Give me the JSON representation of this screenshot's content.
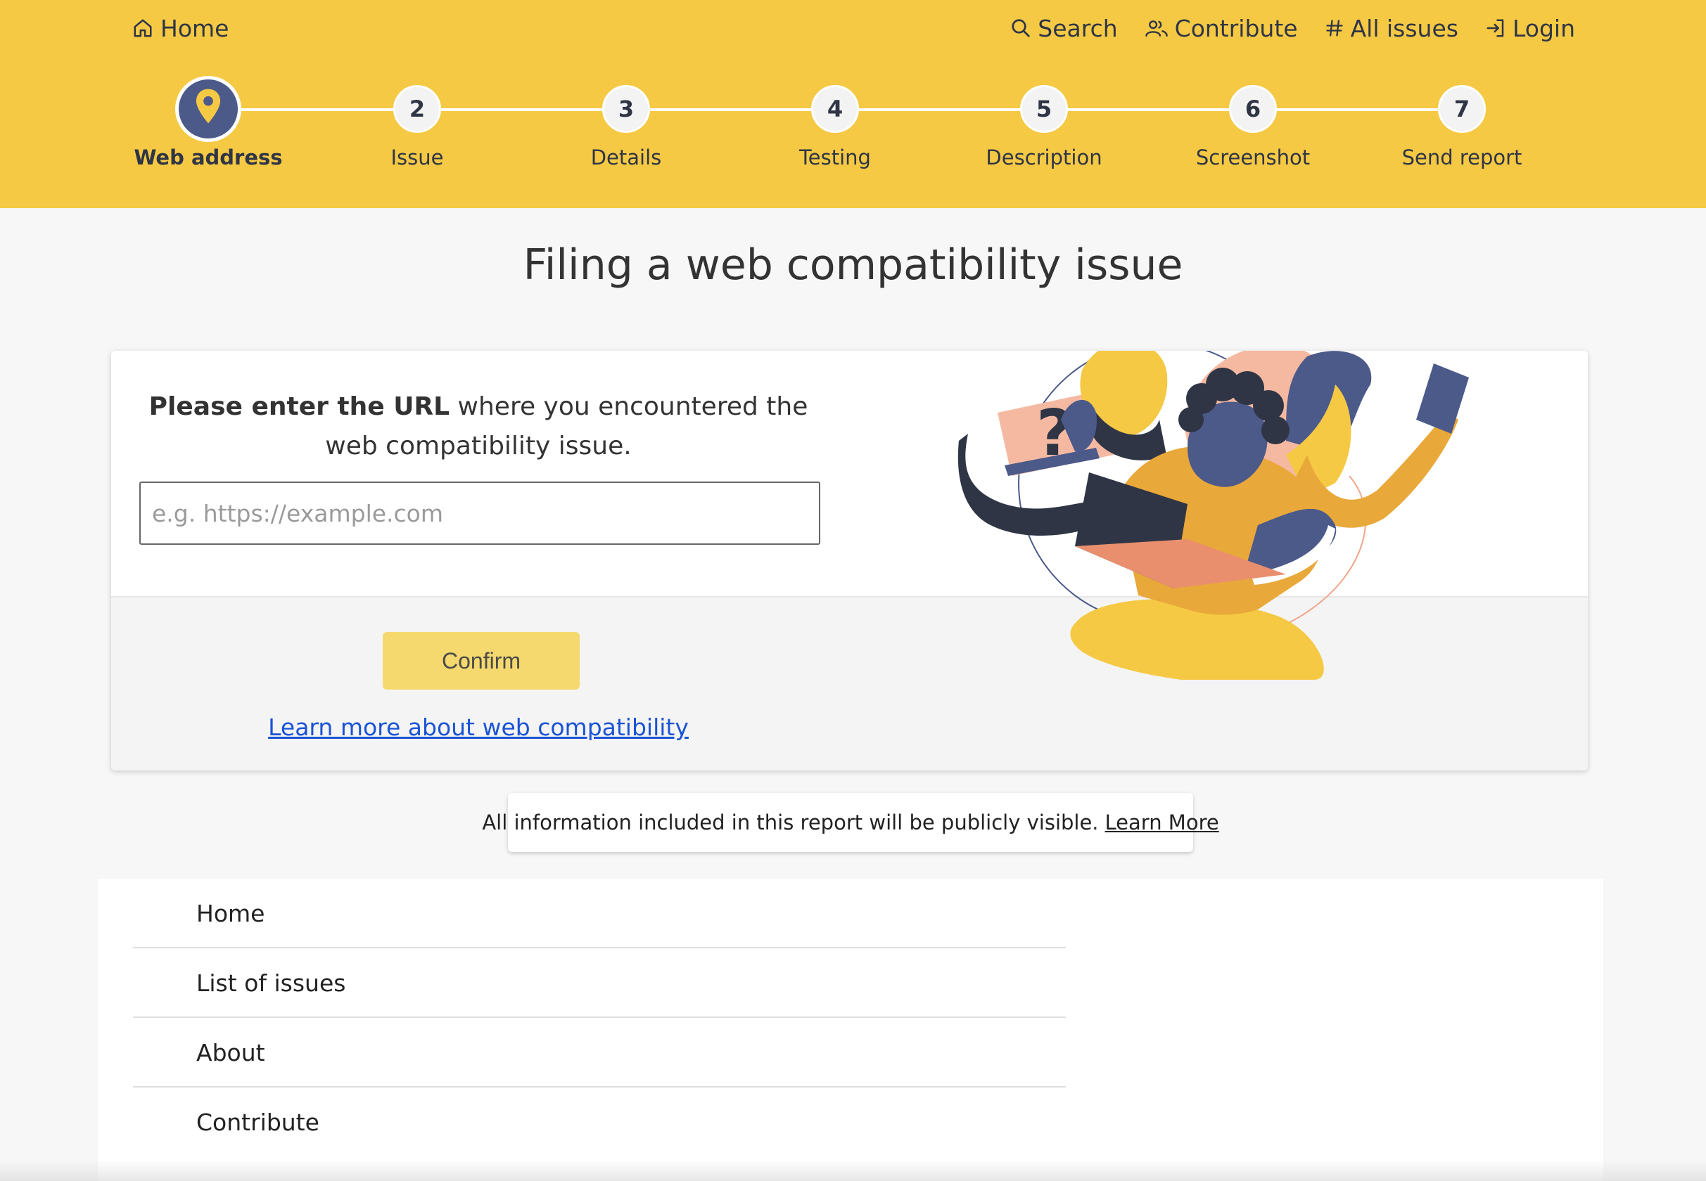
{
  "topnav": {
    "home_label": "Home",
    "links": [
      {
        "label": "Search",
        "icon": "search-icon"
      },
      {
        "label": "Contribute",
        "icon": "people-icon"
      },
      {
        "label": "All issues",
        "icon": "hash-icon"
      },
      {
        "label": "Login",
        "icon": "login-icon"
      }
    ]
  },
  "stepper": {
    "active": 1,
    "steps": [
      {
        "number": "1",
        "label": "Web address",
        "icon": "map-pin-icon"
      },
      {
        "number": "2",
        "label": "Issue"
      },
      {
        "number": "3",
        "label": "Details"
      },
      {
        "number": "4",
        "label": "Testing"
      },
      {
        "number": "5",
        "label": "Description"
      },
      {
        "number": "6",
        "label": "Screenshot"
      },
      {
        "number": "7",
        "label": "Send report"
      }
    ]
  },
  "main": {
    "title": "Filing a web compatibility issue",
    "prompt_bold": "Please enter the URL",
    "prompt_rest": " where you encountered the web compatibility issue.",
    "url_input": {
      "value": "",
      "placeholder": "e.g. https://example.com"
    },
    "confirm_label": "Confirm",
    "learn_link": "Learn more about web compatibility"
  },
  "notice": {
    "text": "All information included in this report will be publicly visible.",
    "link": "Learn More"
  },
  "footer": {
    "links": [
      "Home",
      "List of issues",
      "About",
      "Contribute"
    ]
  },
  "colors": {
    "header": "#f5c944",
    "accent": "#4c5a8a",
    "confirm_button": "#f5d96e",
    "link": "#1a53d6"
  }
}
